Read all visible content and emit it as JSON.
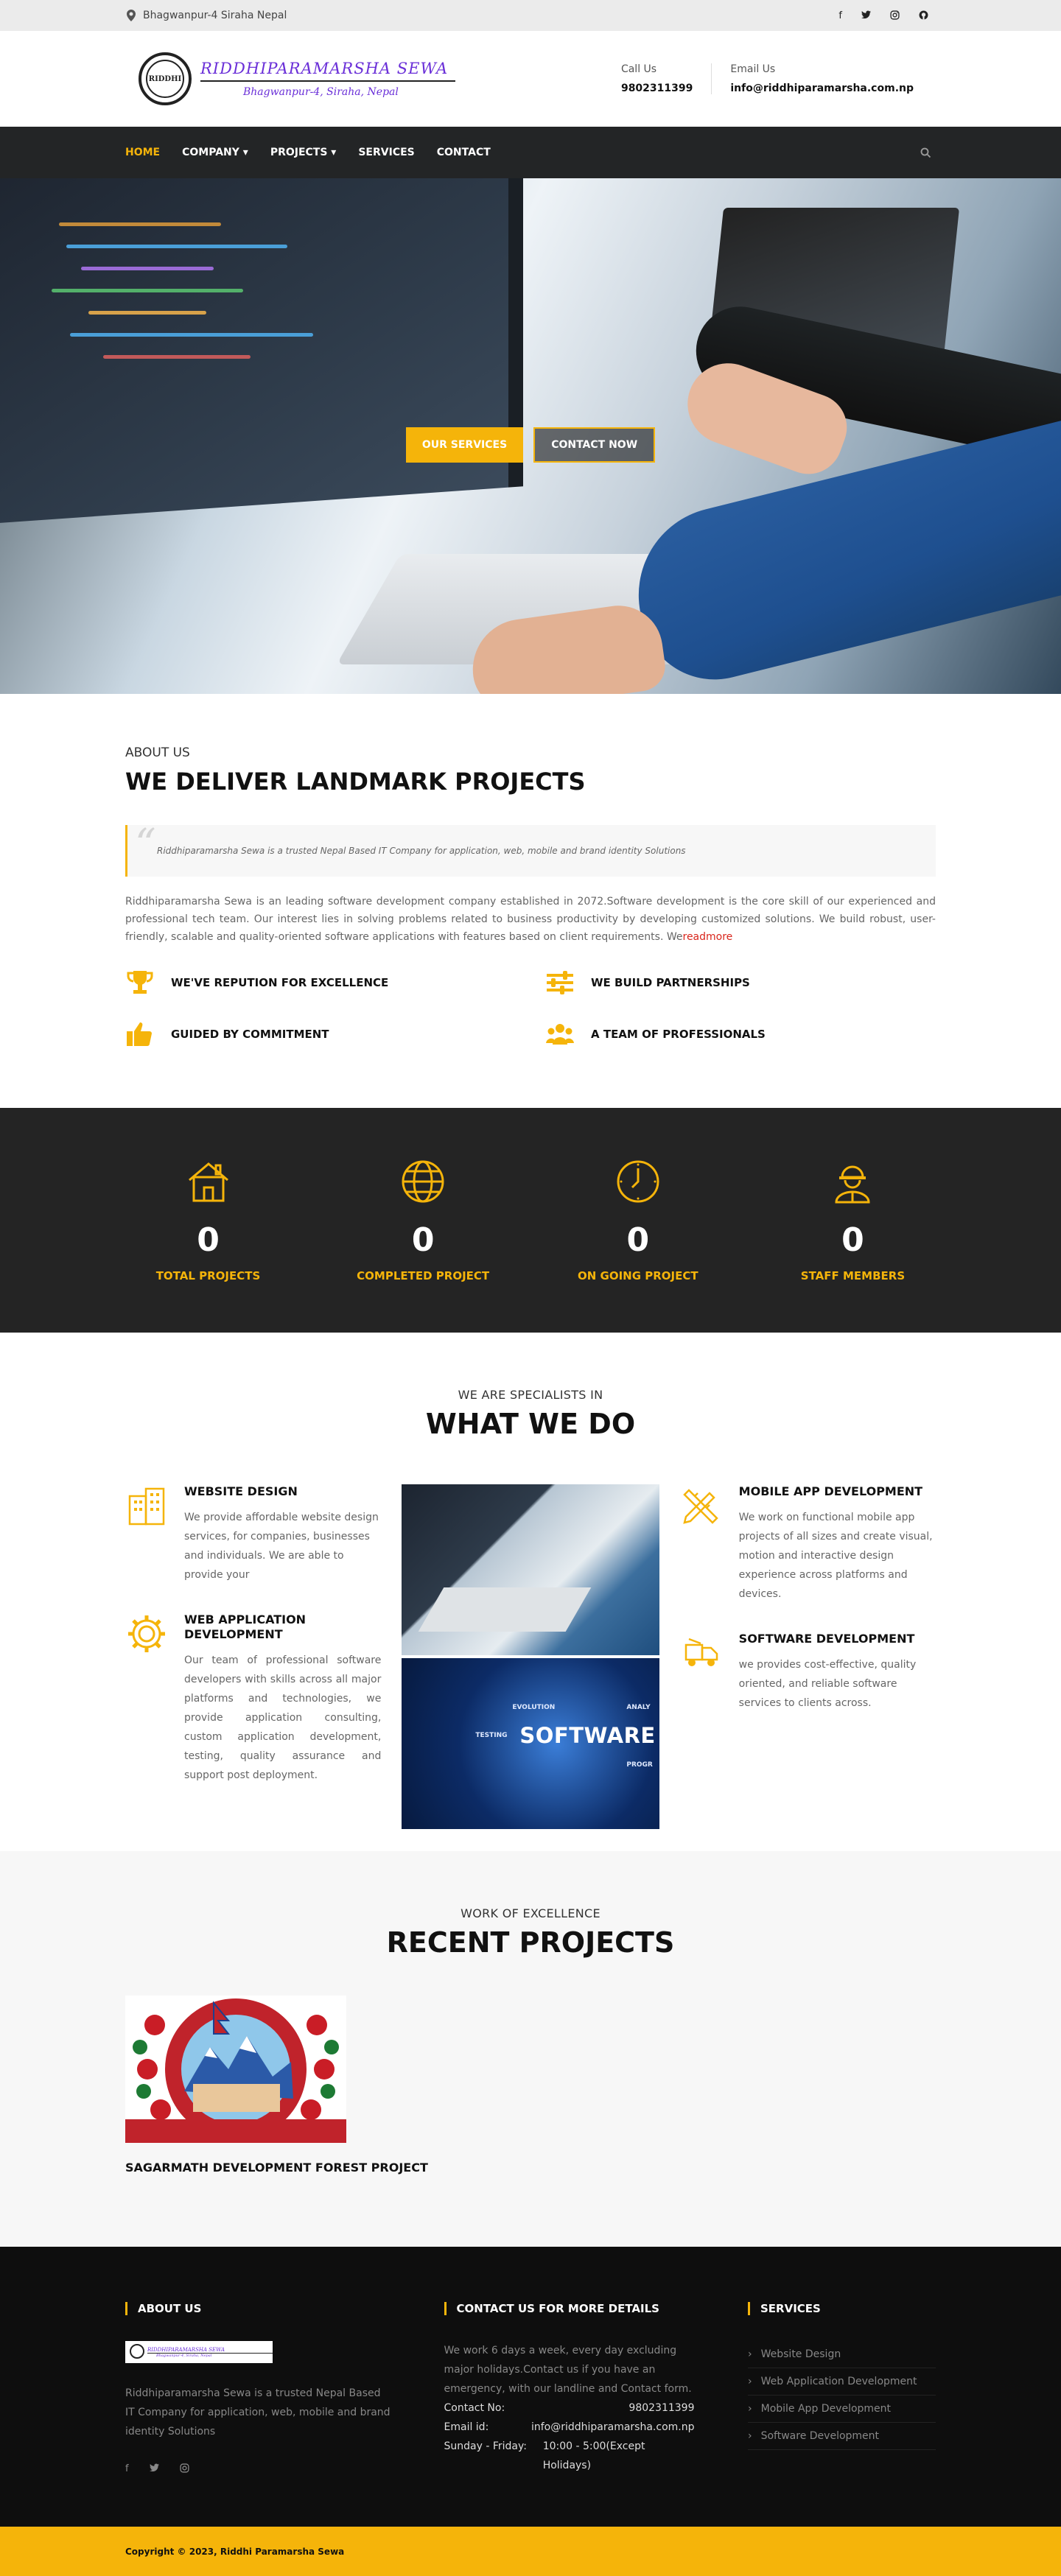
{
  "topbar": {
    "location": "Bhagwanpur-4 Siraha Nepal",
    "social": [
      "facebook-icon",
      "twitter-icon",
      "instagram-icon",
      "github-icon"
    ]
  },
  "header": {
    "logo_name": "RIDDHIPARAMARSHA SEWA",
    "logo_sub": "Bhagwanpur-4, Siraha, Nepal",
    "seal_text": "RIDDHI",
    "call_label": "Call Us",
    "call_value": "9802311399",
    "email_label": "Email Us",
    "email_value": "info@riddhiparamarsha.com.np"
  },
  "nav": {
    "items": [
      {
        "label": "HOME",
        "active": true
      },
      {
        "label": "COMPANY ▾"
      },
      {
        "label": "PROJECTS ▾"
      },
      {
        "label": "SERVICES"
      },
      {
        "label": "CONTACT"
      }
    ]
  },
  "hero": {
    "btn_services": "OUR SERVICES",
    "btn_contact": "CONTACT NOW"
  },
  "about": {
    "sub": "ABOUT US",
    "title": "WE DELIVER LANDMARK PROJECTS",
    "quote": "Riddhiparamarsha Sewa  is a trusted Nepal Based IT Company for application, web, mobile and brand identity Solutions",
    "desc": "Riddhiparamarsha Sewa is an leading software development company established in 2072.Software development is the core skill of our experienced and professional tech team. Our interest lies in solving problems related to business productivity by developing customized solutions. We build robust, user-friendly, scalable and quality-oriented software applications with features based on client requirements. We",
    "readmore": "readmore",
    "features": [
      "WE'VE REPUTION FOR EXCELLENCE",
      "WE BUILD PARTNERSHIPS",
      "GUIDED BY COMMITMENT",
      "A TEAM OF PROFESSIONALS"
    ]
  },
  "stats": [
    {
      "value": "0",
      "label": "TOTAL PROJECTS"
    },
    {
      "value": "0",
      "label": "COMPLETED PROJECT"
    },
    {
      "value": "0",
      "label": "ON GOING PROJECT"
    },
    {
      "value": "0",
      "label": "STAFF MEMBERS"
    }
  ],
  "services": {
    "sub": "WE ARE SPECIALISTS IN",
    "title": "WHAT WE DO",
    "items": [
      {
        "title": "WEBSITE DESIGN",
        "text": "We provide affordable website design services, for companies, businesses and individuals. We are able to provide your"
      },
      {
        "title": "WEB APPLICATION DEVELOPMENT",
        "text": "Our team of professional software developers with skills across all major platforms and technologies, we provide application consulting, custom application development, testing, quality assurance and support post deployment."
      },
      {
        "title": "MOBILE APP DEVELOPMENT",
        "text": "We work on functional mobile app projects of all sizes and create visual, motion and interactive design experience across platforms and devices."
      },
      {
        "title": "SOFTWARE DEVELOPMENT",
        "text": "we provides cost-effective, quality oriented, and reliable software services to clients across."
      }
    ],
    "img2_word": "SOFTWARE",
    "img2_tags": [
      "EVOLUTION",
      "TESTING",
      "ANALY",
      "PROGR"
    ]
  },
  "projects": {
    "sub": "WORK OF EXCELLENCE",
    "title": "RECENT PROJECTS",
    "items": [
      {
        "title": "SAGARMATH DEVELOPMENT FOREST PROJECT"
      }
    ]
  },
  "footer": {
    "about_title": "ABOUT US",
    "about_text": "Riddhiparamarsha Sewa is a trusted Nepal Based IT Company for application, web, mobile and brand identity Solutions",
    "contact_title": "CONTACT US FOR MORE DETAILS",
    "contact_text": "We work 6 days a week, every day excluding major holidays.Contact us if you have an emergency, with our landline and Contact form.",
    "rows": [
      {
        "k": "Contact No:",
        "v": "9802311399"
      },
      {
        "k": "Email id:",
        "v": "info@riddhiparamarsha.com.np"
      },
      {
        "k": "Sunday - Friday:",
        "v": "10:00 - 5:00(Except Holidays)"
      }
    ],
    "services_title": "SERVICES",
    "services": [
      "Website Design",
      "Web Application Development",
      "Mobile App Development",
      "Software Development"
    ],
    "copyright": "Copyright © 2023, Riddhi Paramarsha Sewa"
  },
  "colors": {
    "accent": "#f5b40a",
    "dark": "#232526",
    "link": "#d9261c"
  }
}
